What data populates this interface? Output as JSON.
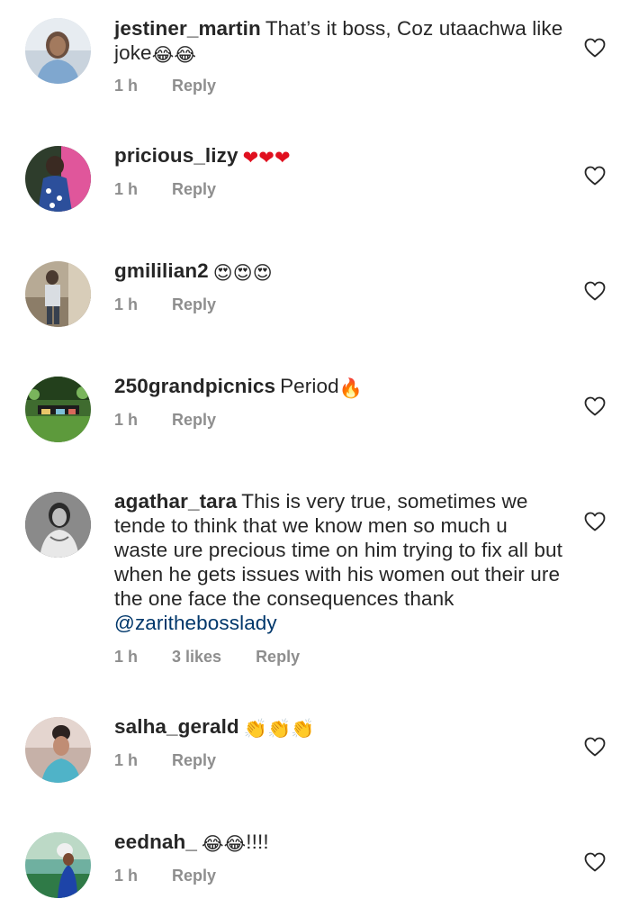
{
  "comments": [
    {
      "username": "jestiner_martin",
      "text": "That’s it boss, Coz utaachwa like joke",
      "emoji": "😂😂",
      "time": "1 h",
      "likes": "",
      "reply": "Reply"
    },
    {
      "username": "pricious_lizy",
      "text": "",
      "emoji": "❤❤❤",
      "time": "1 h",
      "likes": "",
      "reply": "Reply"
    },
    {
      "username": "gmililian2",
      "text": "",
      "emoji": "😍😍😍",
      "time": "1 h",
      "likes": "",
      "reply": "Reply"
    },
    {
      "username": "250grandpicnics",
      "text": "Period",
      "emoji": "🔥",
      "time": "1 h",
      "likes": "",
      "reply": "Reply"
    },
    {
      "username": "agathar_tara",
      "text": "This is very true, sometimes we tende to think that we know men so much u waste ure precious time on him trying to fix all but when he gets issues with his women out their ure the one face the consequences thank",
      "mention": "@zaritheboss​lady",
      "time": "1 h",
      "likes": "3 likes",
      "reply": "Reply"
    },
    {
      "username": "salha_gerald",
      "text": "",
      "emoji": "👏👏👏",
      "time": "1 h",
      "likes": "",
      "reply": "Reply"
    },
    {
      "username": "eednah_",
      "text": "",
      "emoji": "😂😂",
      "suffix": "!!!!",
      "time": "1 h",
      "likes": "",
      "reply": "Reply"
    }
  ],
  "icons": {
    "like": "heart-outline-icon",
    "avatar": "user-avatar"
  },
  "colors": {
    "text": "#262626",
    "meta": "#8e8e8e",
    "mention": "#00376b",
    "heart_stroke": "#262626"
  }
}
